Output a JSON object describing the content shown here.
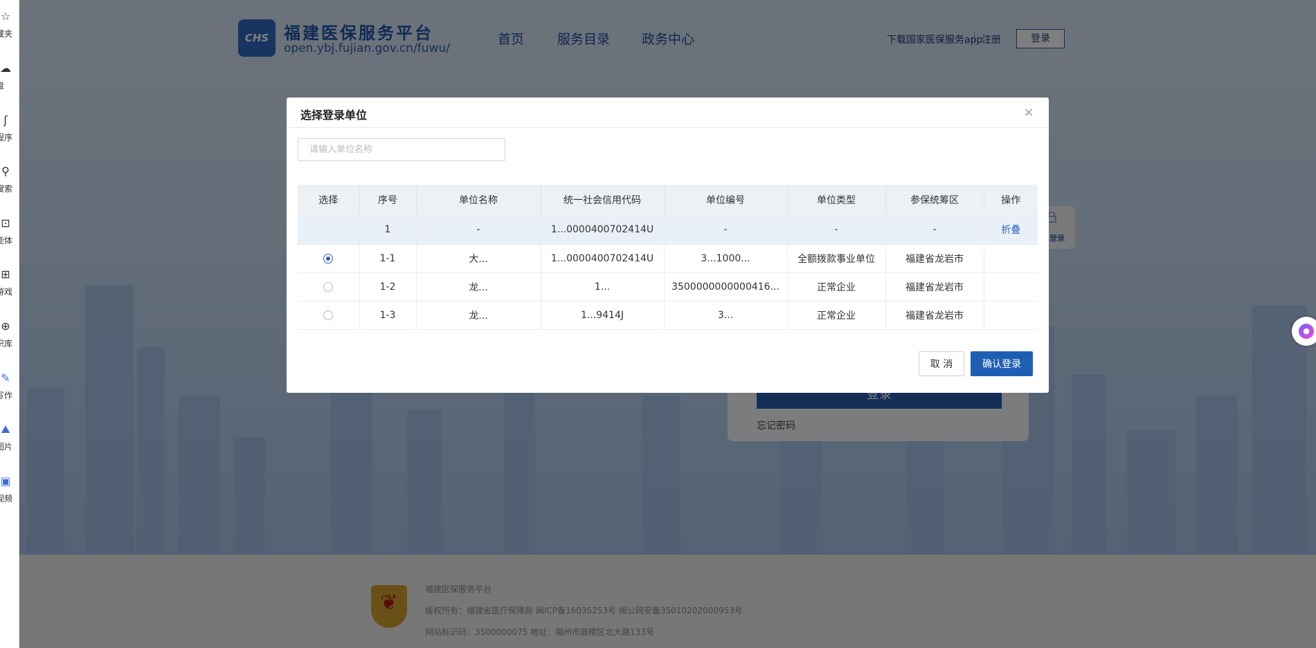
{
  "browser_sidebar": {
    "items": [
      {
        "label": "藏夹",
        "icon": "star-icon"
      },
      {
        "label": "盘",
        "icon": "cloud-icon"
      },
      {
        "label": "程序",
        "icon": "mini-program-icon"
      },
      {
        "label": "搜索",
        "icon": "search-icon"
      },
      {
        "label": "能体",
        "icon": "agent-icon"
      },
      {
        "label": "游戏",
        "icon": "gamepad-icon"
      },
      {
        "label": "识库",
        "icon": "knowledge-icon"
      },
      {
        "label": "写作",
        "icon": "pen-icon"
      },
      {
        "label": "图片",
        "icon": "image-icon"
      },
      {
        "label": "视频",
        "icon": "video-icon"
      }
    ]
  },
  "header": {
    "logo_text": "CHS",
    "title": "福建医保服务平台",
    "url": "open.ybj.fujian.gov.cn/fuwu/",
    "nav": [
      "首页",
      "服务目录",
      "政务中心"
    ],
    "download_app": "下载国家医保服务app",
    "register": "注册",
    "login": "登录"
  },
  "login_card": {
    "ca_label": "CA登录",
    "button": "登录",
    "forgot_password": "忘记密码"
  },
  "footer": {
    "line1": "福建医保服务平台",
    "line2": "版权所有：福建省医疗保障局    闽ICP备16035253号    闽公网安备35010202000953号",
    "line3": "网站标识码：3500000075    地址：福州市鼓楼区北大路133号",
    "emblem_text": "党政机关"
  },
  "modal": {
    "title": "选择登录单位",
    "close": "×",
    "search_placeholder": "请输入单位名称",
    "columns": [
      "选择",
      "序号",
      "单位名称",
      "统一社会信用代码",
      "单位编号",
      "单位类型",
      "参保统筹区",
      "操作"
    ],
    "group_row": {
      "index": "1",
      "name": "-",
      "credit_code": "1‌...0000400702414U",
      "unit_no": "-",
      "type": "-",
      "region": "-",
      "action": "折叠"
    },
    "rows": [
      {
        "selected": true,
        "index": "1-1",
        "name": "大...",
        "credit_code": "1...0000400702414U",
        "unit_no": "3...1000...",
        "type": "全额拨款事业单位",
        "region": "福建省龙岩市"
      },
      {
        "selected": false,
        "index": "1-2",
        "name": "龙...",
        "credit_code": "1...",
        "unit_no": "3500000000000416...",
        "type": "正常企业",
        "region": "福建省龙岩市"
      },
      {
        "selected": false,
        "index": "1-3",
        "name": "龙...",
        "credit_code": "1...9414J",
        "unit_no": "3...",
        "type": "正常企业",
        "region": "福建省龙岩市"
      }
    ],
    "cancel": "取 消",
    "confirm": "确认登录"
  },
  "colors": {
    "primary": "#1e5fb4",
    "header_title": "#1f56a8",
    "table_header_bg": "#edf0f4",
    "group_row_bg": "#eaf0f8"
  }
}
